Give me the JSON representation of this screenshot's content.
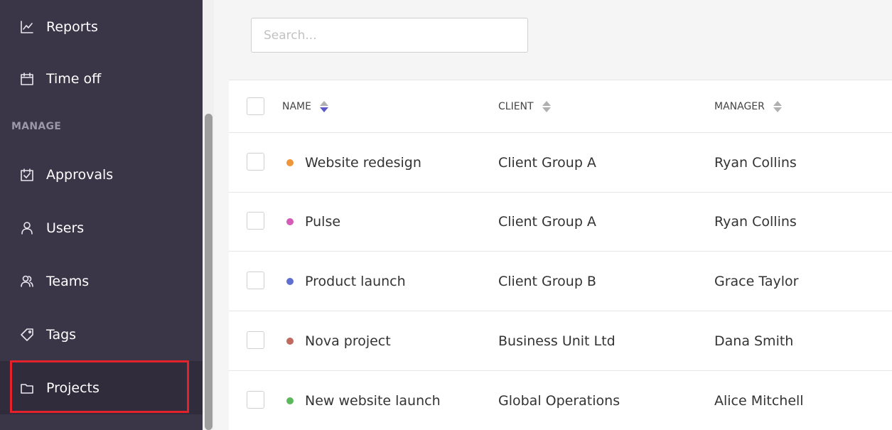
{
  "sidebar": {
    "section_label": "MANAGE",
    "items": [
      {
        "label": "Reports",
        "icon": "reports-icon"
      },
      {
        "label": "Time off",
        "icon": "calendar-icon"
      },
      {
        "label": "Approvals",
        "icon": "approvals-icon"
      },
      {
        "label": "Users",
        "icon": "user-icon"
      },
      {
        "label": "Teams",
        "icon": "teams-icon"
      },
      {
        "label": "Tags",
        "icon": "tag-icon"
      },
      {
        "label": "Projects",
        "icon": "folder-icon",
        "active": true
      }
    ]
  },
  "search": {
    "placeholder": "Search...",
    "value": ""
  },
  "table": {
    "headers": {
      "name": "NAME",
      "client": "CLIENT",
      "manager": "MANAGER"
    },
    "active_sort": "name",
    "rows": [
      {
        "name": "Website redesign",
        "client": "Client Group A",
        "manager": "Ryan Collins",
        "color": "#f0963a"
      },
      {
        "name": "Pulse",
        "client": "Client Group A",
        "manager": "Ryan Collins",
        "color": "#d45bb7"
      },
      {
        "name": "Product launch",
        "client": "Client Group B",
        "manager": "Grace Taylor",
        "color": "#5f6fd0"
      },
      {
        "name": "Nova project",
        "client": "Business Unit Ltd",
        "manager": "Dana Smith",
        "color": "#c06a5e"
      },
      {
        "name": "New website launch",
        "client": "Global Operations",
        "manager": "Alice Mitchell",
        "color": "#5cb85c"
      }
    ]
  },
  "colors": {
    "sidebar_bg": "#3a3547",
    "accent": "#5a57c7",
    "highlight": "#e3222b"
  }
}
